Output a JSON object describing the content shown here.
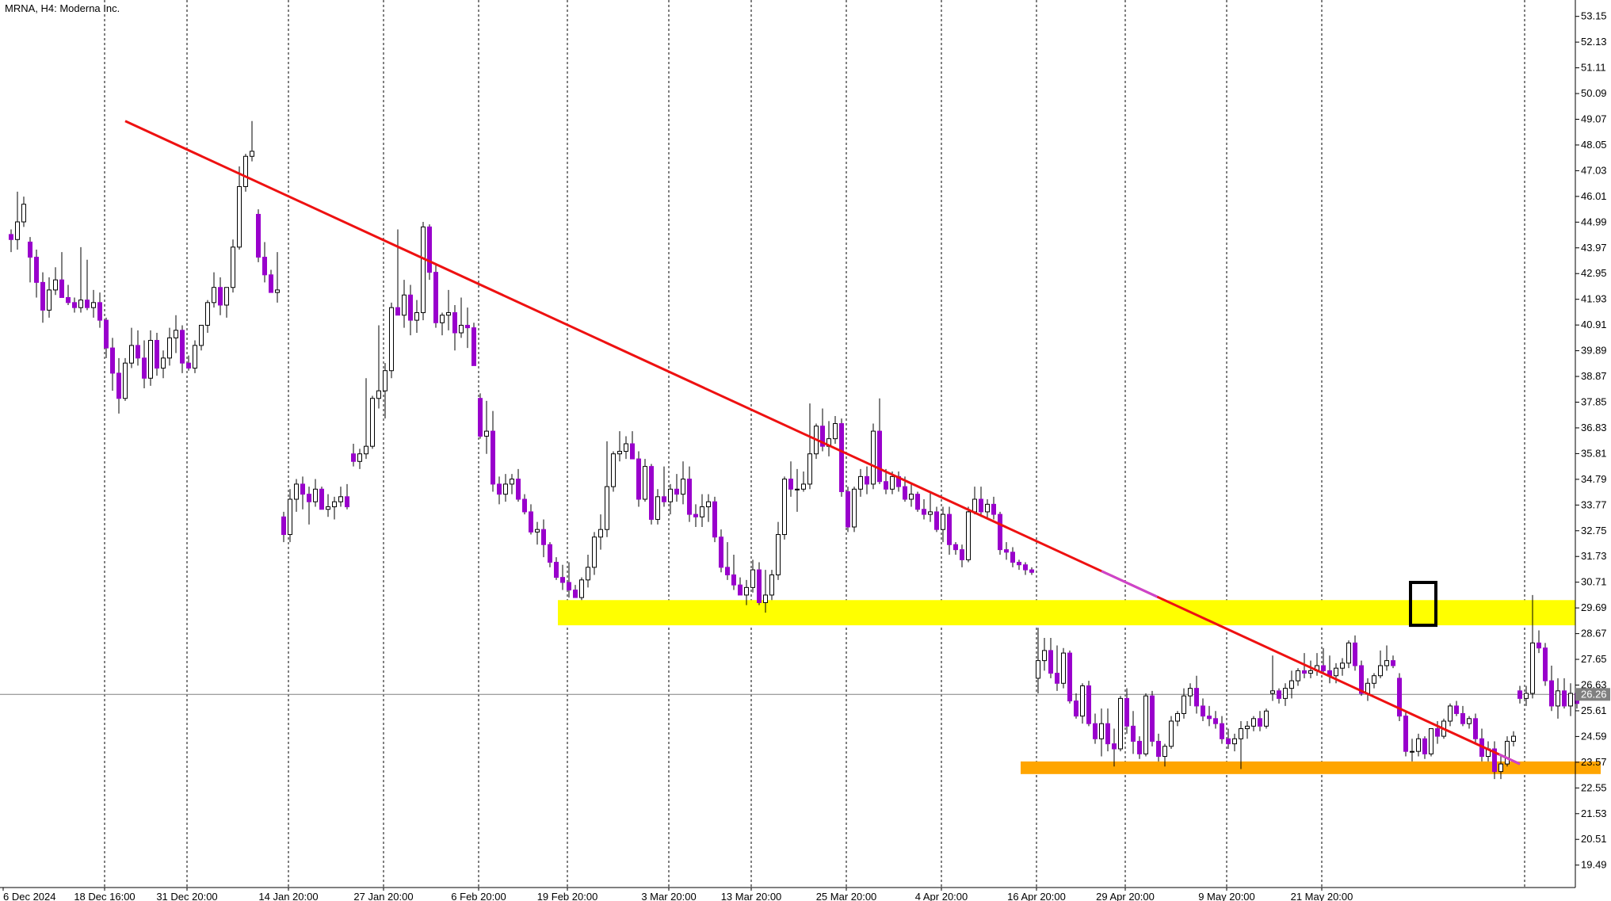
{
  "window": {
    "title": "MRNA, H4:  Moderna Inc."
  },
  "colors": {
    "bear_candle": "#9900CC",
    "bull_candle": "#FFFFFF",
    "wick": "#000000",
    "trendline": "#EE1111",
    "trendline_end": "#CC44CC",
    "resistance_zone": "#FFFF00",
    "support_zone": "#FFA500",
    "grid": "#000000",
    "price_line": "#808080",
    "current_price_bg": "#808080"
  },
  "chart_data": {
    "type": "candlestick",
    "title": "MRNA, H4:  Moderna Inc.",
    "current_price": "26.26",
    "ylim": [
      18.6,
      53.8
    ],
    "y_ticks": [
      "53.15",
      "52.13",
      "51.11",
      "50.09",
      "49.07",
      "48.05",
      "47.03",
      "46.01",
      "44.99",
      "43.97",
      "42.95",
      "41.93",
      "40.91",
      "39.89",
      "38.87",
      "37.85",
      "36.83",
      "35.81",
      "34.79",
      "33.77",
      "32.75",
      "31.73",
      "30.71",
      "29.69",
      "28.67",
      "27.65",
      "26.63",
      "25.61",
      "24.59",
      "23.57",
      "22.55",
      "21.53",
      "20.51",
      "19.49"
    ],
    "x_ticks": [
      "6 Dec 2024",
      "18 Dec 16:00",
      "31 Dec 20:00",
      "14 Jan 20:00",
      "27 Jan 20:00",
      "6 Feb 20:00",
      "19 Feb 20:00",
      "3 Mar 20:00",
      "13 Mar 20:00",
      "25 Mar 20:00",
      "4 Apr 20:00",
      "16 Apr 20:00",
      "29 Apr 20:00",
      "9 May 20:00",
      "21 May 20:00"
    ],
    "trendline": {
      "start": [
        17,
        49.0
      ],
      "end": [
        237,
        23.5
      ]
    },
    "resistance_zone": {
      "from_bar": 87,
      "to_bar": 250,
      "low": 29.0,
      "high": 30.0
    },
    "support_zone": {
      "from_bar": 160,
      "to_bar": 250,
      "low": 23.1,
      "high": 23.6
    },
    "highlight_box": {
      "bar": 223,
      "low": 29.0,
      "high": 30.7
    },
    "candles": [
      [
        44.5,
        44.7,
        43.8,
        44.3
      ],
      [
        44.3,
        46.2,
        43.9,
        45.0
      ],
      [
        45.0,
        46.0,
        44.8,
        45.7
      ],
      [
        44.2,
        44.4,
        42.6,
        43.6
      ],
      [
        43.6,
        43.9,
        42.0,
        42.6
      ],
      [
        42.6,
        43.0,
        41.0,
        41.5
      ],
      [
        41.5,
        42.8,
        41.2,
        42.3
      ],
      [
        42.3,
        43.2,
        42.1,
        42.7
      ],
      [
        42.7,
        43.8,
        42.0,
        42.0
      ],
      [
        42.0,
        42.5,
        41.7,
        41.8
      ],
      [
        41.8,
        42.0,
        41.4,
        41.6
      ],
      [
        41.6,
        44.0,
        41.4,
        41.9
      ],
      [
        41.9,
        43.5,
        41.5,
        41.6
      ],
      [
        41.6,
        42.3,
        41.2,
        41.8
      ],
      [
        41.8,
        42.2,
        40.8,
        41.1
      ],
      [
        41.1,
        41.2,
        39.6,
        40.0
      ],
      [
        40.0,
        40.4,
        38.3,
        39.0
      ],
      [
        39.0,
        39.6,
        37.4,
        38.0
      ],
      [
        38.0,
        39.6,
        37.9,
        39.4
      ],
      [
        39.4,
        40.8,
        39.2,
        40.1
      ],
      [
        40.1,
        40.7,
        39.3,
        39.6
      ],
      [
        39.6,
        40.3,
        38.4,
        38.8
      ],
      [
        38.8,
        40.7,
        38.5,
        40.3
      ],
      [
        40.3,
        40.6,
        38.9,
        39.2
      ],
      [
        39.2,
        39.9,
        38.8,
        39.6
      ],
      [
        39.6,
        40.8,
        39.3,
        40.4
      ],
      [
        40.4,
        41.3,
        39.8,
        40.7
      ],
      [
        40.7,
        40.9,
        39.0,
        39.4
      ],
      [
        39.4,
        39.7,
        39.1,
        39.2
      ],
      [
        39.2,
        40.3,
        39.0,
        40.1
      ],
      [
        40.1,
        40.9,
        39.9,
        40.9
      ],
      [
        40.9,
        41.9,
        40.6,
        41.8
      ],
      [
        41.8,
        43.0,
        41.6,
        42.4
      ],
      [
        42.4,
        42.8,
        41.3,
        41.7
      ],
      [
        41.7,
        42.4,
        41.2,
        42.4
      ],
      [
        42.4,
        44.3,
        42.2,
        44.0
      ],
      [
        44.0,
        47.2,
        43.9,
        46.4
      ],
      [
        46.4,
        47.7,
        46.2,
        47.6
      ],
      [
        47.6,
        49.0,
        47.4,
        47.8
      ],
      [
        45.3,
        45.5,
        43.4,
        43.6
      ],
      [
        43.6,
        44.2,
        42.6,
        42.9
      ],
      [
        42.9,
        43.1,
        42.2,
        42.2
      ],
      [
        42.2,
        43.8,
        41.8,
        42.3
      ],
      [
        33.3,
        33.5,
        32.3,
        32.6
      ],
      [
        32.6,
        34.4,
        32.3,
        34.0
      ],
      [
        34.0,
        34.8,
        33.5,
        34.6
      ],
      [
        34.6,
        34.9,
        33.6,
        34.2
      ],
      [
        34.2,
        34.5,
        33.0,
        33.9
      ],
      [
        33.9,
        34.8,
        33.7,
        34.4
      ],
      [
        34.4,
        34.5,
        33.6,
        33.6
      ],
      [
        33.6,
        34.2,
        33.3,
        33.7
      ],
      [
        33.7,
        34.1,
        33.2,
        33.9
      ],
      [
        33.9,
        34.5,
        33.7,
        34.1
      ],
      [
        34.1,
        34.6,
        33.6,
        33.7
      ],
      [
        35.8,
        36.2,
        35.3,
        35.5
      ],
      [
        35.5,
        36.0,
        35.2,
        35.8
      ],
      [
        35.8,
        38.8,
        35.6,
        36.1
      ],
      [
        36.1,
        38.1,
        36.0,
        38.0
      ],
      [
        38.0,
        40.9,
        37.6,
        38.3
      ],
      [
        38.3,
        39.4,
        37.2,
        39.1
      ],
      [
        39.1,
        41.8,
        38.8,
        41.6
      ],
      [
        41.6,
        44.7,
        41.3,
        41.3
      ],
      [
        41.3,
        42.7,
        40.8,
        42.1
      ],
      [
        42.1,
        42.5,
        40.5,
        41.1
      ],
      [
        41.1,
        41.9,
        40.6,
        41.4
      ],
      [
        41.4,
        45.0,
        41.1,
        44.8
      ],
      [
        44.8,
        44.9,
        42.7,
        43.0
      ],
      [
        43.0,
        43.3,
        40.8,
        41.0
      ],
      [
        41.0,
        41.4,
        40.5,
        41.3
      ],
      [
        41.3,
        42.3,
        40.7,
        41.4
      ],
      [
        41.4,
        41.7,
        39.9,
        40.6
      ],
      [
        40.6,
        42.0,
        40.4,
        40.9
      ],
      [
        40.9,
        41.6,
        40.0,
        40.8
      ],
      [
        40.8,
        41.0,
        39.9,
        39.3
      ],
      [
        38.0,
        38.2,
        36.4,
        36.5
      ],
      [
        36.5,
        37.9,
        35.8,
        36.7
      ],
      [
        36.7,
        37.5,
        34.3,
        34.6
      ],
      [
        34.6,
        34.9,
        33.8,
        34.2
      ],
      [
        34.2,
        35.0,
        33.9,
        34.6
      ],
      [
        34.6,
        35.0,
        34.2,
        34.8
      ],
      [
        34.8,
        35.2,
        33.9,
        34.0
      ],
      [
        34.0,
        34.2,
        33.4,
        33.5
      ],
      [
        33.5,
        33.8,
        32.6,
        32.7
      ],
      [
        32.7,
        33.1,
        32.2,
        32.8
      ],
      [
        32.8,
        33.2,
        31.7,
        32.2
      ],
      [
        32.2,
        32.3,
        31.3,
        31.5
      ],
      [
        31.5,
        31.7,
        30.8,
        30.9
      ],
      [
        30.9,
        31.4,
        30.4,
        30.7
      ],
      [
        30.7,
        31.5,
        30.1,
        30.4
      ],
      [
        30.4,
        30.6,
        30.1,
        30.1
      ],
      [
        30.1,
        30.9,
        30.0,
        30.8
      ],
      [
        30.8,
        31.8,
        30.5,
        31.3
      ],
      [
        31.3,
        32.7,
        31.0,
        32.5
      ],
      [
        32.5,
        33.4,
        32.0,
        32.8
      ],
      [
        32.8,
        36.3,
        32.5,
        34.5
      ],
      [
        34.5,
        35.9,
        34.3,
        35.8
      ],
      [
        35.8,
        36.7,
        35.5,
        35.9
      ],
      [
        35.9,
        36.5,
        35.6,
        36.2
      ],
      [
        36.2,
        36.7,
        35.7,
        35.6
      ],
      [
        35.6,
        35.9,
        33.7,
        34.0
      ],
      [
        34.0,
        35.6,
        33.9,
        35.3
      ],
      [
        35.3,
        35.4,
        33.0,
        33.2
      ],
      [
        33.2,
        34.4,
        33.0,
        34.1
      ],
      [
        34.1,
        35.3,
        33.7,
        33.9
      ],
      [
        33.9,
        34.6,
        33.4,
        34.4
      ],
      [
        34.4,
        35.0,
        33.9,
        34.2
      ],
      [
        34.2,
        35.5,
        33.8,
        34.8
      ],
      [
        34.8,
        35.3,
        33.1,
        33.4
      ],
      [
        33.4,
        33.8,
        32.9,
        33.3
      ],
      [
        33.3,
        34.2,
        32.9,
        33.7
      ],
      [
        33.7,
        34.2,
        33.1,
        33.9
      ],
      [
        33.9,
        34.1,
        32.3,
        32.5
      ],
      [
        32.5,
        32.8,
        31.1,
        31.3
      ],
      [
        31.3,
        32.3,
        30.8,
        31.0
      ],
      [
        31.0,
        31.8,
        30.4,
        30.6
      ],
      [
        30.6,
        30.9,
        30.2,
        30.2
      ],
      [
        30.2,
        30.8,
        29.8,
        30.5
      ],
      [
        30.5,
        31.6,
        30.3,
        31.2
      ],
      [
        31.2,
        31.5,
        29.8,
        29.9
      ],
      [
        29.9,
        31.2,
        29.5,
        30.2
      ],
      [
        30.2,
        31.2,
        30.0,
        31.0
      ],
      [
        31.0,
        33.1,
        30.8,
        32.6
      ],
      [
        32.6,
        34.9,
        32.4,
        34.8
      ],
      [
        34.8,
        35.5,
        34.1,
        34.4
      ],
      [
        34.4,
        35.2,
        33.5,
        34.4
      ],
      [
        34.4,
        35.1,
        34.3,
        34.6
      ],
      [
        34.6,
        37.8,
        34.4,
        35.8
      ],
      [
        35.8,
        37.0,
        35.6,
        36.9
      ],
      [
        36.9,
        37.6,
        35.9,
        36.1
      ],
      [
        36.1,
        37.1,
        35.7,
        36.4
      ],
      [
        36.4,
        37.3,
        36.2,
        37.0
      ],
      [
        37.0,
        37.2,
        34.1,
        34.3
      ],
      [
        34.3,
        34.5,
        32.7,
        32.9
      ],
      [
        32.9,
        34.5,
        32.7,
        34.4
      ],
      [
        34.4,
        35.2,
        34.1,
        34.9
      ],
      [
        34.9,
        35.3,
        34.2,
        34.6
      ],
      [
        34.6,
        37.0,
        34.4,
        36.7
      ],
      [
        36.7,
        38.0,
        34.6,
        34.7
      ],
      [
        34.7,
        35.2,
        34.2,
        34.4
      ],
      [
        34.4,
        35.1,
        34.2,
        34.9
      ],
      [
        34.9,
        35.1,
        34.3,
        34.5
      ],
      [
        34.5,
        34.9,
        33.9,
        34.0
      ],
      [
        34.0,
        34.6,
        33.7,
        34.2
      ],
      [
        34.2,
        34.3,
        33.5,
        33.6
      ],
      [
        33.6,
        34.0,
        33.2,
        33.4
      ],
      [
        33.4,
        34.3,
        33.1,
        33.5
      ],
      [
        33.5,
        33.7,
        32.7,
        32.8
      ],
      [
        32.8,
        33.7,
        32.3,
        33.4
      ],
      [
        33.4,
        33.7,
        31.8,
        32.2
      ],
      [
        32.2,
        32.3,
        31.8,
        32.0
      ],
      [
        32.0,
        32.2,
        31.3,
        31.6
      ],
      [
        31.6,
        33.7,
        31.5,
        33.5
      ],
      [
        33.5,
        34.5,
        33.4,
        34.0
      ],
      [
        34.0,
        34.5,
        33.3,
        33.5
      ],
      [
        33.5,
        34.0,
        33.2,
        33.8
      ],
      [
        33.8,
        34.1,
        33.2,
        33.4
      ],
      [
        33.4,
        33.5,
        31.8,
        32.0
      ],
      [
        32.0,
        32.3,
        31.6,
        31.9
      ],
      [
        31.9,
        32.1,
        31.3,
        31.5
      ],
      [
        31.5,
        31.6,
        31.2,
        31.4
      ],
      [
        31.4,
        31.5,
        31.0,
        31.2
      ],
      [
        31.2,
        31.3,
        31.0,
        31.1
      ],
      [
        26.9,
        28.9,
        26.3,
        27.6
      ],
      [
        27.6,
        28.5,
        27.2,
        28.0
      ],
      [
        28.0,
        28.5,
        26.9,
        27.1
      ],
      [
        27.1,
        28.2,
        26.4,
        26.7
      ],
      [
        26.7,
        28.1,
        26.5,
        27.9
      ],
      [
        27.9,
        28.0,
        25.9,
        26.0
      ],
      [
        26.0,
        26.3,
        25.3,
        25.4
      ],
      [
        25.4,
        26.7,
        25.1,
        26.6
      ],
      [
        26.6,
        26.8,
        25.0,
        25.1
      ],
      [
        25.1,
        25.5,
        24.3,
        24.5
      ],
      [
        24.5,
        25.7,
        23.8,
        25.1
      ],
      [
        25.1,
        25.7,
        24.0,
        24.3
      ],
      [
        24.3,
        24.9,
        23.4,
        24.1
      ],
      [
        24.1,
        26.2,
        24.0,
        26.1
      ],
      [
        26.1,
        26.5,
        24.7,
        25.0
      ],
      [
        25.0,
        25.6,
        23.9,
        24.4
      ],
      [
        24.4,
        24.6,
        23.7,
        23.9
      ],
      [
        23.9,
        26.3,
        23.8,
        26.2
      ],
      [
        26.2,
        26.4,
        24.2,
        24.4
      ],
      [
        24.4,
        24.7,
        23.6,
        23.8
      ],
      [
        23.8,
        24.3,
        23.4,
        24.2
      ],
      [
        24.2,
        25.4,
        24.1,
        25.2
      ],
      [
        25.2,
        25.6,
        25.0,
        25.5
      ],
      [
        25.5,
        26.5,
        25.3,
        26.2
      ],
      [
        26.2,
        26.7,
        25.8,
        26.5
      ],
      [
        26.5,
        27.0,
        25.5,
        25.8
      ],
      [
        25.8,
        26.1,
        25.2,
        25.4
      ],
      [
        25.4,
        25.8,
        25.0,
        25.3
      ],
      [
        25.3,
        25.6,
        24.9,
        25.1
      ],
      [
        25.1,
        25.4,
        24.3,
        24.5
      ],
      [
        24.5,
        24.9,
        24.1,
        24.3
      ],
      [
        24.3,
        24.7,
        24.0,
        24.5
      ],
      [
        24.5,
        25.2,
        23.3,
        24.9
      ],
      [
        24.9,
        25.2,
        24.5,
        25.0
      ],
      [
        25.0,
        25.4,
        24.8,
        25.3
      ],
      [
        25.3,
        25.6,
        24.8,
        25.0
      ],
      [
        25.0,
        25.7,
        24.9,
        25.6
      ],
      [
        26.3,
        27.8,
        26.0,
        26.4
      ],
      [
        26.4,
        26.5,
        25.9,
        26.1
      ],
      [
        26.1,
        26.7,
        25.8,
        26.5
      ],
      [
        26.5,
        27.2,
        26.1,
        26.8
      ],
      [
        26.8,
        27.3,
        26.6,
        27.2
      ],
      [
        27.2,
        27.9,
        26.9,
        27.1
      ],
      [
        27.1,
        27.6,
        26.9,
        27.2
      ],
      [
        27.2,
        27.9,
        27.0,
        27.4
      ],
      [
        27.4,
        28.1,
        27.1,
        27.2
      ],
      [
        27.2,
        27.8,
        26.7,
        27.0
      ],
      [
        27.0,
        27.5,
        26.7,
        27.3
      ],
      [
        27.3,
        27.7,
        27.0,
        27.5
      ],
      [
        27.5,
        28.4,
        27.3,
        28.3
      ],
      [
        28.3,
        28.6,
        27.2,
        27.4
      ],
      [
        27.4,
        27.6,
        26.2,
        26.3
      ],
      [
        26.3,
        26.9,
        26.0,
        26.7
      ],
      [
        26.7,
        27.1,
        26.5,
        27.0
      ],
      [
        27.0,
        28.0,
        26.9,
        27.4
      ],
      [
        27.4,
        28.2,
        27.2,
        27.6
      ],
      [
        27.6,
        27.8,
        27.3,
        27.4
      ],
      [
        26.9,
        27.1,
        25.2,
        25.4
      ],
      [
        25.4,
        25.6,
        23.8,
        24.0
      ],
      [
        24.0,
        24.5,
        23.6,
        24.0
      ],
      [
        24.0,
        24.7,
        23.8,
        24.5
      ],
      [
        24.5,
        24.6,
        23.7,
        23.9
      ],
      [
        23.9,
        24.9,
        23.8,
        24.9
      ],
      [
        24.9,
        25.2,
        24.3,
        24.6
      ],
      [
        24.6,
        25.3,
        24.5,
        25.2
      ],
      [
        25.2,
        25.9,
        25.0,
        25.8
      ],
      [
        25.8,
        26.0,
        25.4,
        25.5
      ],
      [
        25.5,
        25.8,
        25.0,
        25.1
      ],
      [
        25.1,
        25.4,
        24.9,
        25.3
      ],
      [
        25.3,
        25.5,
        24.3,
        24.5
      ],
      [
        24.5,
        24.9,
        23.6,
        23.8
      ],
      [
        23.8,
        24.4,
        23.6,
        24.1
      ],
      [
        24.1,
        24.4,
        22.9,
        23.2
      ],
      [
        23.2,
        23.8,
        22.9,
        23.5
      ],
      [
        23.5,
        24.6,
        23.4,
        24.4
      ],
      [
        24.4,
        24.8,
        24.2,
        24.6
      ],
      [
        26.4,
        26.6,
        25.9,
        26.1
      ],
      [
        26.1,
        26.6,
        25.8,
        26.3
      ],
      [
        26.3,
        30.2,
        26.1,
        28.3
      ],
      [
        28.3,
        28.8,
        27.9,
        28.1
      ],
      [
        28.1,
        28.3,
        26.6,
        26.8
      ],
      [
        26.8,
        27.4,
        25.6,
        25.8
      ],
      [
        25.8,
        26.9,
        25.3,
        26.4
      ],
      [
        26.4,
        26.9,
        25.7,
        25.8
      ],
      [
        25.8,
        26.7,
        25.4,
        26.3
      ],
      [
        26.3,
        26.5,
        25.7,
        25.9
      ]
    ]
  }
}
